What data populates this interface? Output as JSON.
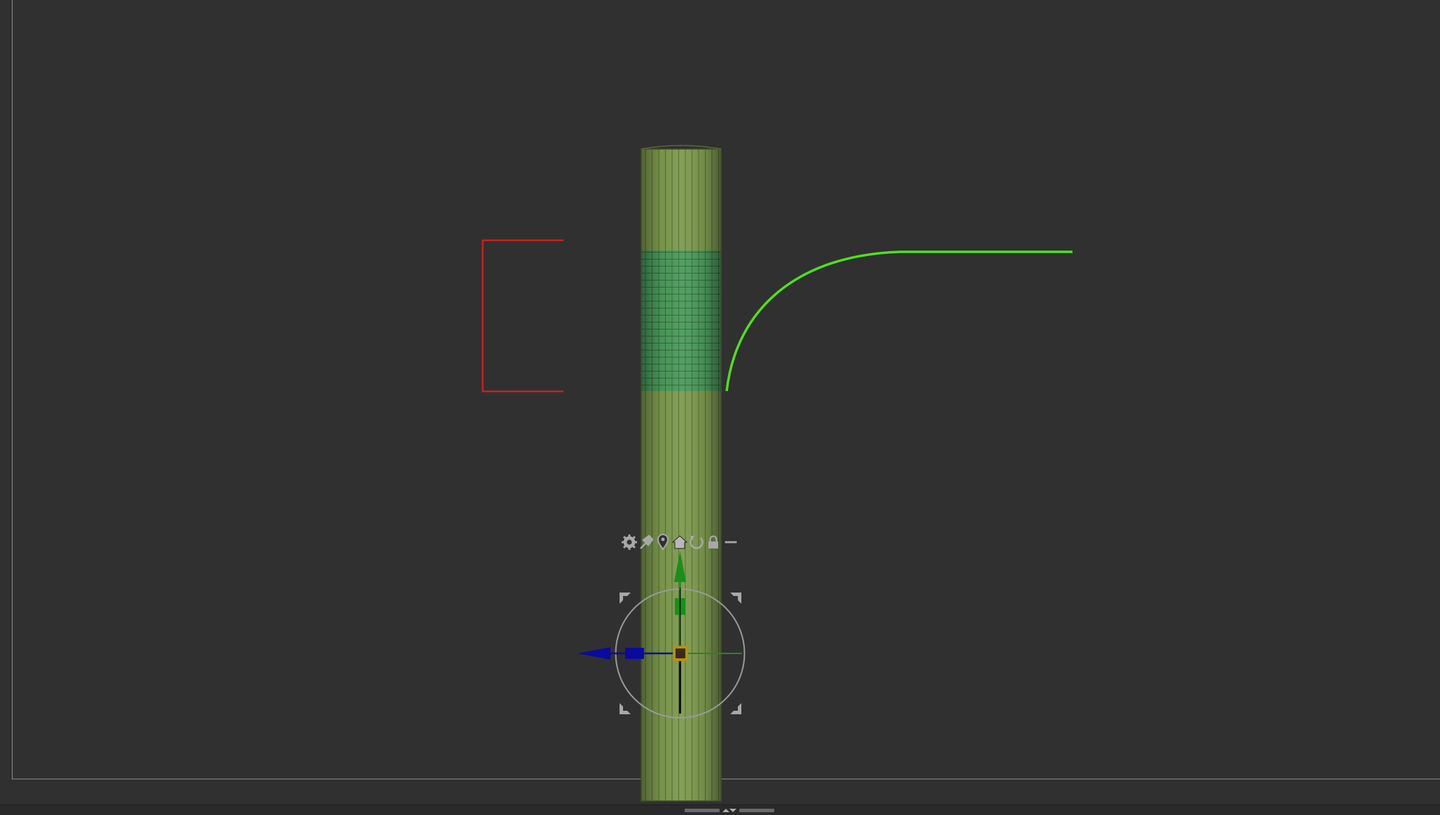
{
  "app": {
    "view": "3D viewport"
  },
  "colors": {
    "background": "#303030",
    "frame_line": "#8a8a8a",
    "mesh_base": "#7d9a4e",
    "mesh_dark": "#4f6231",
    "mesh_highlight": "#4c9a5c",
    "curve": "#4fe11a",
    "selection_bracket": "#e0201e",
    "gizmo_y": "#1a8f1a",
    "gizmo_x": "#0a0aa0",
    "gizmo_ring": "#9a9a9a",
    "gizmo_center": "#b8900e"
  },
  "gizmo_toolbar": {
    "icons": [
      "gear-icon",
      "pin-icon",
      "location-pin-icon",
      "home-icon",
      "rotate-reset-icon",
      "lock-icon",
      "minus-icon"
    ]
  },
  "bottom_bar": {
    "icons": [
      "collapse-up-icon",
      "collapse-down-icon"
    ]
  }
}
